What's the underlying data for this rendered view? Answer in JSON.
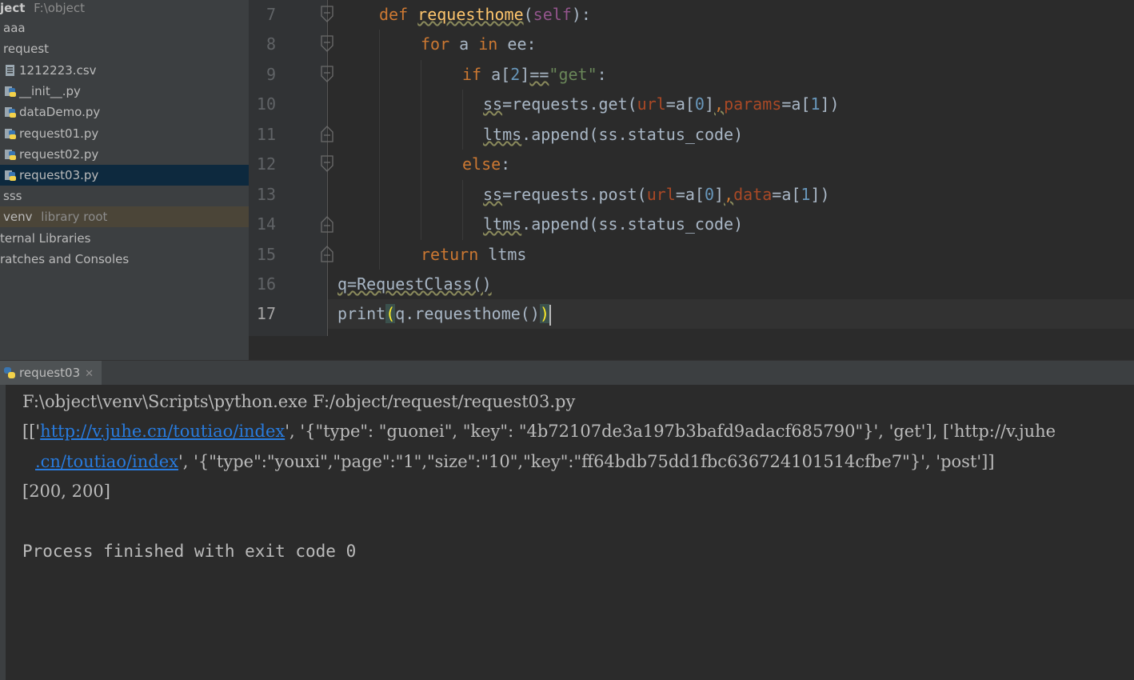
{
  "project_tree": {
    "root_label": "ject",
    "root_path": "F:\\object",
    "items": [
      {
        "label": "aaa"
      },
      {
        "label": "request"
      },
      {
        "label": "1212223.csv"
      },
      {
        "label": "__init__.py"
      },
      {
        "label": "dataDemo.py"
      },
      {
        "label": "request01.py"
      },
      {
        "label": "request02.py"
      },
      {
        "label": "request03.py"
      },
      {
        "label": "sss"
      },
      {
        "label": "venv",
        "suffix": "library root"
      },
      {
        "label": "ternal Libraries"
      },
      {
        "label": "ratches and Consoles"
      }
    ]
  },
  "editor": {
    "lines": [
      "7",
      "8",
      "9",
      "10",
      "11",
      "12",
      "13",
      "14",
      "15",
      "16",
      "17"
    ],
    "code": {
      "l7": [
        "def",
        "requesthome",
        "(",
        "self",
        "):"
      ],
      "l8": [
        "for",
        "a",
        "in",
        "ee:"
      ],
      "l9": [
        "if",
        "a[",
        "2",
        "]",
        "==",
        "\"get\"",
        ":"
      ],
      "l10": [
        "ss",
        "=requests.get(",
        "url",
        "=a[",
        "0",
        "]",
        ",",
        "params",
        "=a[",
        "1",
        "])"
      ],
      "l11": [
        "ltms",
        ".append(ss.status_code)"
      ],
      "l12": [
        "else",
        ":"
      ],
      "l13": [
        "ss",
        "=requests.post(",
        "url",
        "=a[",
        "0",
        "]",
        ",",
        "data",
        "=a[",
        "1",
        "])"
      ],
      "l14": [
        "ltms",
        ".append(ss.status_code)"
      ],
      "l15": [
        "return",
        "ltms"
      ],
      "l16": [
        "q=RequestClass()"
      ],
      "l17": [
        "print",
        "(",
        "q.requesthome()",
        ")"
      ]
    }
  },
  "run": {
    "tab_label": "request03",
    "output": {
      "cmd": "F:\\object\\venv\\Scripts\\python.exe F:/object/request/request03.py",
      "l2_prefix": "[['",
      "l2_link": "http://v.juhe.cn/toutiao/index",
      "l2_rest": "', '{\"type\": \"guonei\", \"key\": \"4b72107de3a197b3bafd9adacf685790\"}', 'get'], ['http://v.juhe",
      "l3_link": ".cn/toutiao/index",
      "l3_rest": "', '{\"type\":\"youxi\",\"page\":\"1\",\"size\":\"10\",\"key\":\"ff64bdb75dd1fbc636724101514cfbe7\"}', 'post']]",
      "result": "[200, 200]",
      "exit": "Process finished with exit code 0"
    }
  },
  "colors": {
    "keyword": "#cc7832",
    "function": "#ffc66d",
    "string": "#6a8759",
    "number": "#6897bb",
    "link": "#287bde"
  }
}
